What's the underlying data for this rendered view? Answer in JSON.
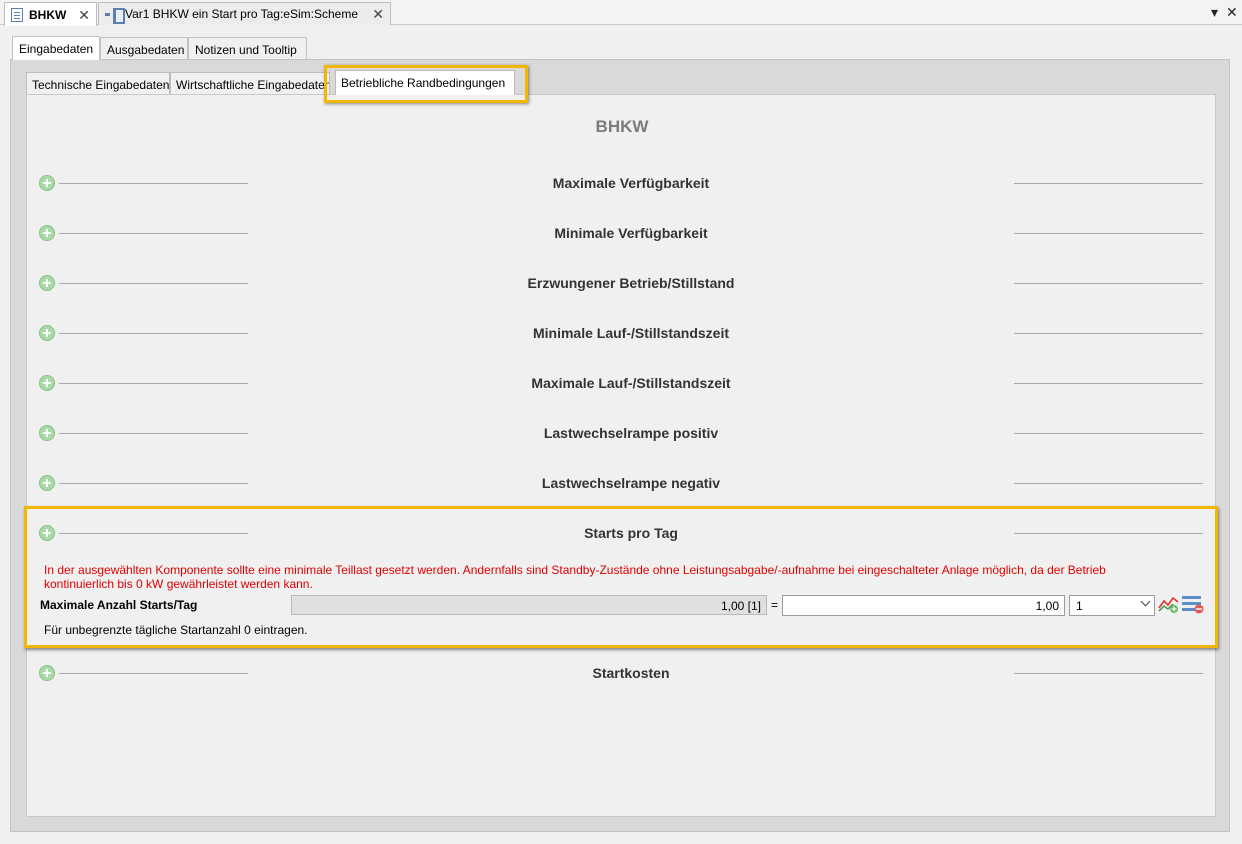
{
  "editor_tabs": [
    {
      "label": "BHKW"
    },
    {
      "label": "Var1 BHKW ein Start pro Tag:eSim:Scheme"
    }
  ],
  "main_tabs": [
    {
      "label": "Eingabedaten"
    },
    {
      "label": "Ausgabedaten"
    },
    {
      "label": "Notizen und Tooltip"
    }
  ],
  "sub_tabs": [
    {
      "label": "Technische Eingabedaten"
    },
    {
      "label": "Wirtschaftliche Eingabedaten"
    },
    {
      "label": "Betriebliche Randbedingungen"
    }
  ],
  "component_title": "BHKW",
  "sections": [
    {
      "title": "Maximale Verfügbarkeit"
    },
    {
      "title": "Minimale Verfügbarkeit"
    },
    {
      "title": "Erzwungener Betrieb/Stillstand"
    },
    {
      "title": "Minimale Lauf-/Stillstandszeit"
    },
    {
      "title": "Maximale Lauf-/Stillstandszeit"
    },
    {
      "title": "Lastwechselrampe positiv"
    },
    {
      "title": "Lastwechselrampe negativ"
    },
    {
      "title": "Starts pro Tag"
    },
    {
      "title": "Startkosten"
    }
  ],
  "starts_section": {
    "warning_line1": "In der ausgewählten Komponente sollte eine minimale Teillast gesetzt werden. Andernfalls sind Standby-Zustände ohne Leistungsabgabe/-aufnahme bei eingeschalteter Anlage möglich, da der Betrieb",
    "warning_line2": "kontinuierlich bis 0 kW gewährleistet werden kann.",
    "param_label": "Maximale Anzahl Starts/Tag",
    "computed_value": "1,00 [1]",
    "equals": "=",
    "input_value": "1,00",
    "select_value": "1",
    "hint": "Für unbegrenzte tägliche Startanzahl 0 eintragen."
  },
  "colors": {
    "highlight": "#f2b705",
    "warning": "#e00000",
    "plus_icon": "#a9d9a6"
  }
}
